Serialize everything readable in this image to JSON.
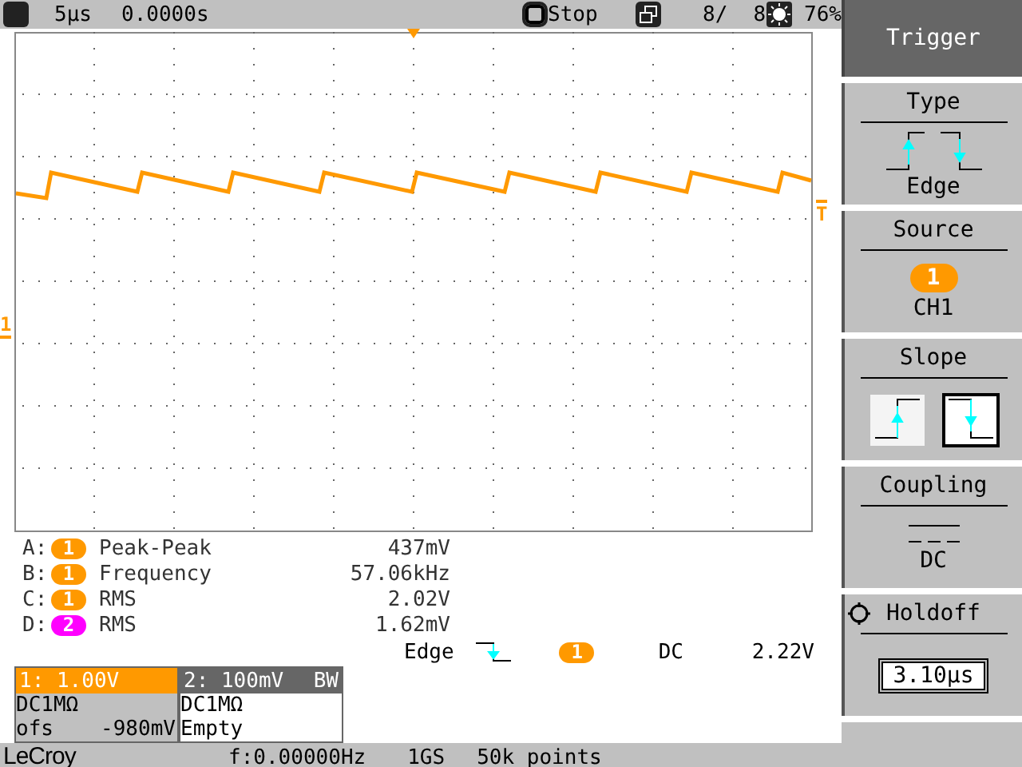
{
  "top_bar": {
    "timebase": "5µs",
    "delay": "0.0000s",
    "run_state": "Stop",
    "sweeps": "8/",
    "sweeps_total": "8",
    "brightness": "76%"
  },
  "plot": {
    "channel_marker": "1",
    "trigger_marker": "T"
  },
  "measurements": [
    {
      "label": "A:",
      "channel": "1",
      "color": "#ff9900",
      "name": "Peak-Peak",
      "value": "437mV"
    },
    {
      "label": "B:",
      "channel": "1",
      "color": "#ff9900",
      "name": "Frequency",
      "value": "57.06kHz"
    },
    {
      "label": "C:",
      "channel": "1",
      "color": "#ff9900",
      "name": "RMS",
      "value": "2.02V"
    },
    {
      "label": "D:",
      "channel": "2",
      "color": "#ff00ff",
      "name": "RMS",
      "value": "1.62mV"
    }
  ],
  "trigger_summary": {
    "type": "Edge",
    "channel": "1",
    "color": "#ff9900",
    "coupling": "DC",
    "voltage": "2.22V"
  },
  "channels": [
    {
      "header": "1: 1.00V",
      "selected": true,
      "coupling": "DC1MΩ",
      "offset_label": "ofs",
      "offset": "-980mV"
    },
    {
      "header": "2: 100mV",
      "bw": "BW",
      "selected": false,
      "coupling": "DC1MΩ",
      "status": "Empty"
    }
  ],
  "status_bar": {
    "logo": "LeCroy",
    "frequency": "f:0.00000Hz",
    "sample_rate": "1GS",
    "record_length": "50k points"
  },
  "menu": {
    "title": "Trigger",
    "items": [
      {
        "kind": "type",
        "label": "Type",
        "value": "Edge"
      },
      {
        "kind": "source",
        "label": "Source",
        "badge": "1",
        "color": "#ff9900",
        "value": "CH1"
      },
      {
        "kind": "slope",
        "label": "Slope",
        "options": [
          {
            "kind": "rising",
            "selected": false
          },
          {
            "kind": "falling",
            "selected": true
          }
        ]
      },
      {
        "kind": "coupling",
        "label": "Coupling",
        "value": "DC"
      },
      {
        "kind": "knob",
        "label": "Holdoff",
        "value": "3.10µs"
      }
    ]
  }
}
